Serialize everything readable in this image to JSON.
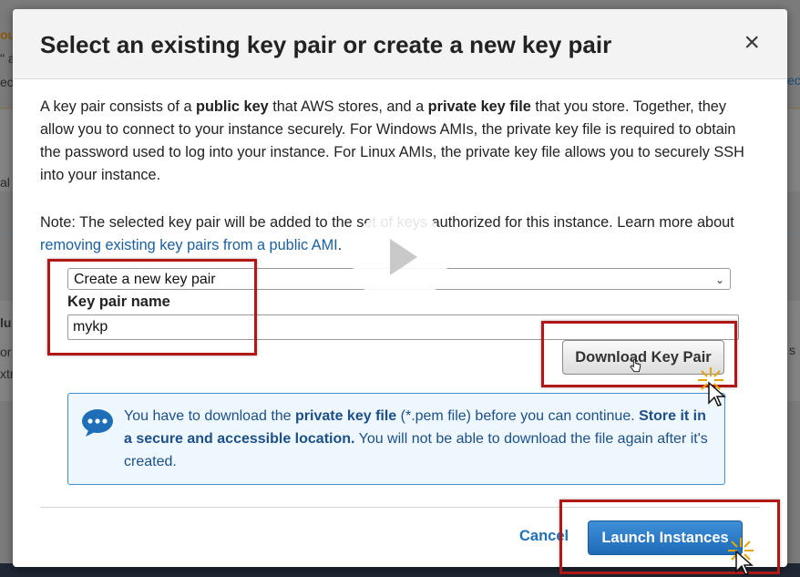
{
  "background": {
    "fragments": [
      "ou",
      "\" a",
      "ecu",
      "al",
      "lu",
      "or",
      "xtr",
      "ec",
      "s"
    ]
  },
  "modal": {
    "title": "Select an existing key pair or create a new key pair",
    "close_label": "×",
    "intro": {
      "p1": "A key pair consists of a ",
      "b1": "public key",
      "p2": " that AWS stores, and a ",
      "b2": "private key file",
      "p3": " that you store. Together, they allow you to connect to your instance securely. For Windows AMIs, the private key file is required to obtain the password used to log into your instance. For Linux AMIs, the private key file allows you to securely SSH into your instance."
    },
    "note": {
      "text": "Note: The selected key pair will be added to the set of keys authorized for this instance. Learn more about ",
      "link": "removing existing key pairs from a public AMI",
      "end": "."
    },
    "key_pair_select": {
      "selected": "Create a new key pair",
      "chevron": "⌄"
    },
    "key_pair_name": {
      "label": "Key pair name",
      "value": "mykp"
    },
    "download_button": "Download Key Pair",
    "info": {
      "t1": "You have to download the ",
      "b1": "private key file",
      "t2": " (*.pem file) before you can continue. ",
      "b2": "Store it in a secure and accessible location.",
      "t3": " You will not be able to download the file again after it's created."
    },
    "cancel_button": "Cancel",
    "launch_button": "Launch Instances"
  },
  "colors": {
    "highlight": "#b01818",
    "primary": "#1e6bb8",
    "info_border": "#3d8fd0",
    "link": "#1a5fa0"
  },
  "icons": [
    "close-icon",
    "chat-bubble-icon",
    "play-icon",
    "pointer-cursor-icon",
    "click-burst-icon",
    "chevron-down-icon"
  ]
}
